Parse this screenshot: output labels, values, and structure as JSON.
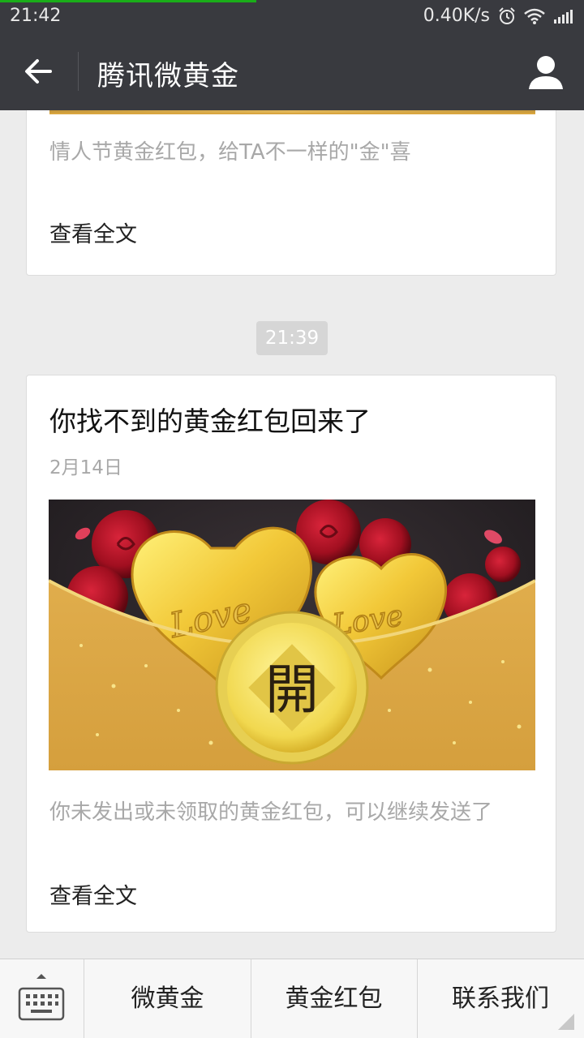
{
  "status_bar": {
    "time": "21:42",
    "network_speed": "0.40K/s"
  },
  "header": {
    "title": "腾讯微黄金"
  },
  "articles": [
    {
      "digest": "情人节黄金红包，给TA不一样的\"金\"喜",
      "read_more": "查看全文"
    },
    {
      "title": "你找不到的黄金红包回来了",
      "date": "2月14日",
      "cover_text": "開",
      "cover_word_1": "Love",
      "cover_word_2": "Love",
      "digest": "你未发出或未领取的黄金红包，可以继续发送了",
      "read_more": "查看全文"
    }
  ],
  "timestamp": "21:39",
  "menu": {
    "items": [
      "微黄金",
      "黄金红包",
      "联系我们"
    ]
  },
  "colors": {
    "bar": "#393a3f",
    "background": "#ececec",
    "gold": "#d9a640",
    "accent": "#1aad19"
  }
}
